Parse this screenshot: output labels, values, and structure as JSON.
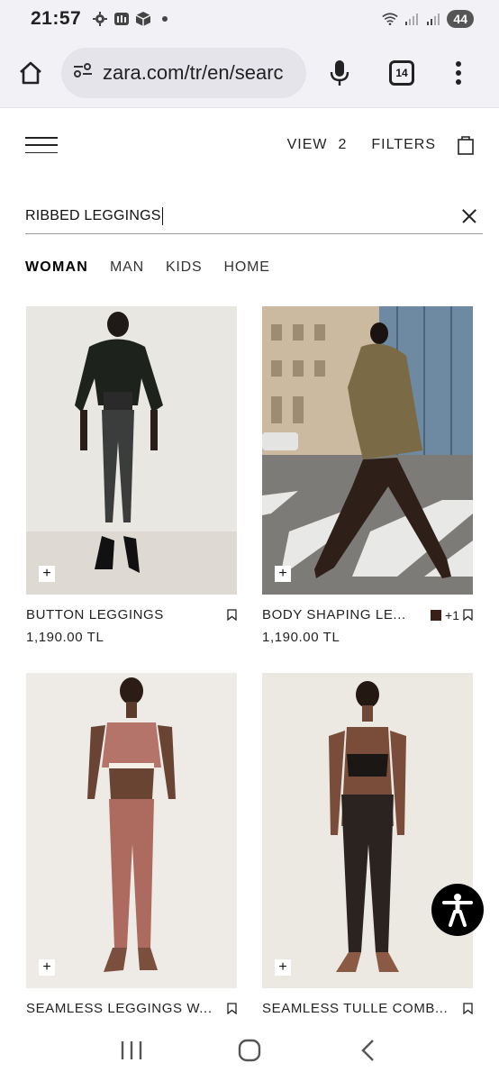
{
  "status_bar": {
    "time": "21:57",
    "battery": "44"
  },
  "browser": {
    "url": "zara.com/tr/en/searc",
    "tab_count": "14"
  },
  "header": {
    "view_label": "VIEW",
    "view_value": "2",
    "filters_label": "FILTERS"
  },
  "search": {
    "value": "RIBBED LEGGINGS"
  },
  "categories": [
    {
      "label": "WOMAN",
      "active": true
    },
    {
      "label": "MAN",
      "active": false
    },
    {
      "label": "KIDS",
      "active": false
    },
    {
      "label": "HOME",
      "active": false
    }
  ],
  "products": [
    {
      "name": "BUTTON LEGGINGS",
      "price": "1,190.00 TL",
      "extra_colors": ""
    },
    {
      "name": "BODY SHAPING LE...",
      "price": "1,190.00 TL",
      "extra_colors": "+1",
      "swatch_color": "#3a1f18"
    },
    {
      "name": "SEAMLESS LEGGINGS W...",
      "price": "",
      "extra_colors": ""
    },
    {
      "name": "SEAMLESS TULLE COMB...",
      "price": "",
      "extra_colors": ""
    }
  ],
  "icons": {
    "add": "+"
  }
}
